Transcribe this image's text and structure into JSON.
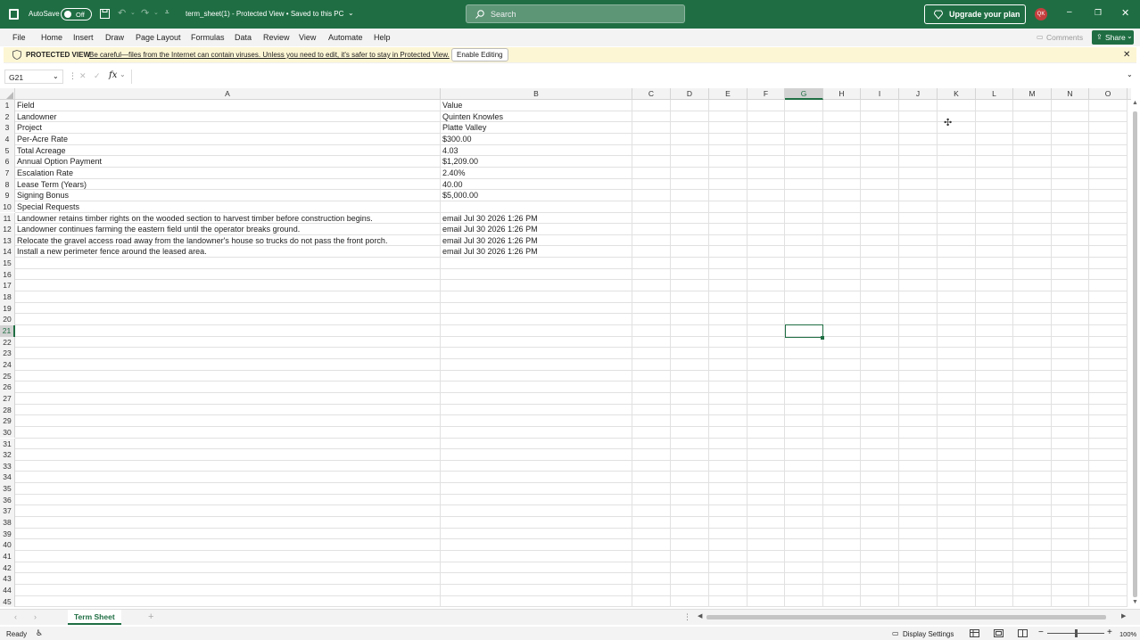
{
  "titlebar": {
    "autosave_label": "AutoSave",
    "autosave_state": "Off",
    "doc_title": "term_sheet(1)  -  Protected View • Saved to this PC",
    "search_placeholder": "Search",
    "upgrade_label": "Upgrade your plan",
    "avatar_initials": "QK",
    "colors": {
      "bar": "#1f6e43",
      "avatar": "#c43e3e"
    }
  },
  "ribbon": {
    "tabs": [
      "File",
      "Home",
      "Insert",
      "Draw",
      "Page Layout",
      "Formulas",
      "Data",
      "Review",
      "View",
      "Automate",
      "Help"
    ],
    "comments_label": "Comments",
    "share_label": "Share"
  },
  "protected_view": {
    "title": "PROTECTED VIEW",
    "message": "Be careful—files from the Internet can contain viruses. Unless you need to edit, it's safer to stay in Protected View.",
    "button": "Enable Editing"
  },
  "formula_bar": {
    "name_box": "G21",
    "fx_label": "fx",
    "formula": ""
  },
  "grid": {
    "columns": [
      "A",
      "B",
      "C",
      "D",
      "E",
      "F",
      "G",
      "H",
      "I",
      "J",
      "K",
      "L",
      "M",
      "N",
      "O"
    ],
    "selected_column": "G",
    "selected_row": 21,
    "row_count": 45,
    "rows": [
      [
        "Field",
        "Value"
      ],
      [
        "Landowner",
        "Quinten Knowles"
      ],
      [
        "Project",
        "Platte Valley"
      ],
      [
        "Per-Acre Rate",
        "$300.00"
      ],
      [
        "Total Acreage",
        "4.03"
      ],
      [
        "Annual Option Payment",
        "$1,209.00"
      ],
      [
        "Escalation Rate",
        "2.40%"
      ],
      [
        "Lease Term (Years)",
        "40.00"
      ],
      [
        "Signing Bonus",
        "$5,000.00"
      ],
      [
        "Special Requests",
        ""
      ],
      [
        "Landowner retains timber rights on the wooded section to harvest timber before construction begins.",
        "email Jul 30 2026 1:26 PM"
      ],
      [
        "Landowner continues farming the eastern field until the operator breaks ground.",
        "email Jul 30 2026 1:26 PM"
      ],
      [
        "Relocate the gravel access road away from the landowner's house so trucks do not pass the front porch.",
        "email Jul 30 2026 1:26 PM"
      ],
      [
        "Install a new perimeter fence around the leased area.",
        "email Jul 30 2026 1:26 PM"
      ]
    ]
  },
  "sheet_tabs": {
    "active": "Term Sheet"
  },
  "status": {
    "ready": "Ready",
    "display_settings": "Display Settings",
    "zoom": "100%"
  }
}
